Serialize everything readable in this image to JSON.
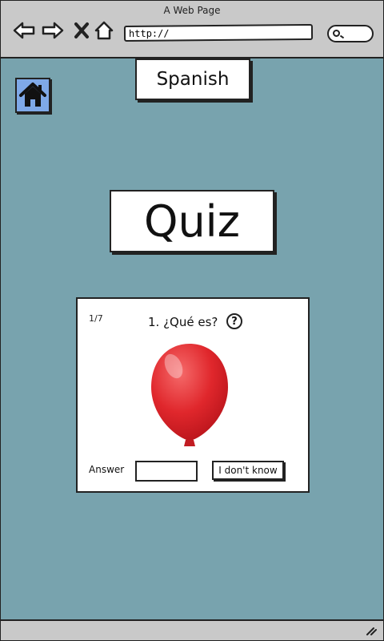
{
  "browser": {
    "window_title": "A Web Page",
    "url": "http://",
    "icons": [
      "back-arrow-icon",
      "forward-arrow-icon",
      "close-x-icon",
      "home-outline-icon",
      "search-icon"
    ]
  },
  "header": {
    "language_label": "Spanish",
    "home_icon": "home-icon"
  },
  "main": {
    "title": "Quiz"
  },
  "quiz": {
    "counter": "1/7",
    "question": "1. ¿Qué es?",
    "help_icon_glyph": "?",
    "image": "red-balloon",
    "answer_label": "Answer",
    "answer_value": "",
    "dont_know_label": "I don't know"
  },
  "colors": {
    "page_background": "#78a3ae",
    "chrome": "#c9c9c9",
    "home_button": "#7fa9e8",
    "balloon": "#e0272c"
  }
}
